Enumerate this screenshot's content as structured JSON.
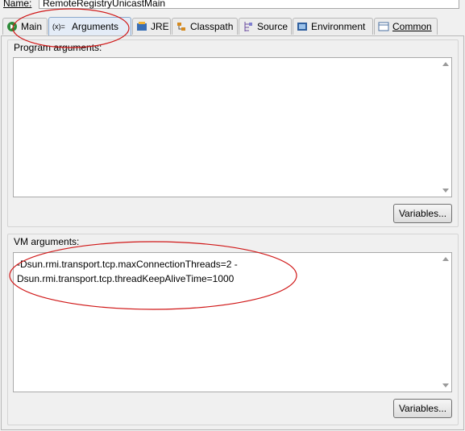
{
  "name_row": {
    "label": "Name:",
    "value": "RemoteRegistryUnicastMain"
  },
  "tabs": [
    {
      "label": "Main",
      "icon": "main-run-icon",
      "active": false
    },
    {
      "label": "Arguments",
      "icon": "arguments-icon",
      "active": true
    },
    {
      "label": "JRE",
      "icon": "jre-icon",
      "active": false
    },
    {
      "label": "Classpath",
      "icon": "classpath-icon",
      "active": false
    },
    {
      "label": "Source",
      "icon": "source-icon",
      "active": false
    },
    {
      "label": "Environment",
      "icon": "environment-icon",
      "active": false
    },
    {
      "label": "Common",
      "icon": "common-icon",
      "active": false
    }
  ],
  "program_args": {
    "label": "Program arguments:",
    "value": "",
    "variables_button": "Variables..."
  },
  "vm_args": {
    "label": "VM arguments:",
    "value": "-Dsun.rmi.transport.tcp.maxConnectionThreads=2 -\nDsun.rmi.transport.tcp.threadKeepAliveTime=1000",
    "variables_button": "Variables..."
  },
  "colors": {
    "annotation_red": "#d01818",
    "active_tab": "#e4ecf7"
  }
}
